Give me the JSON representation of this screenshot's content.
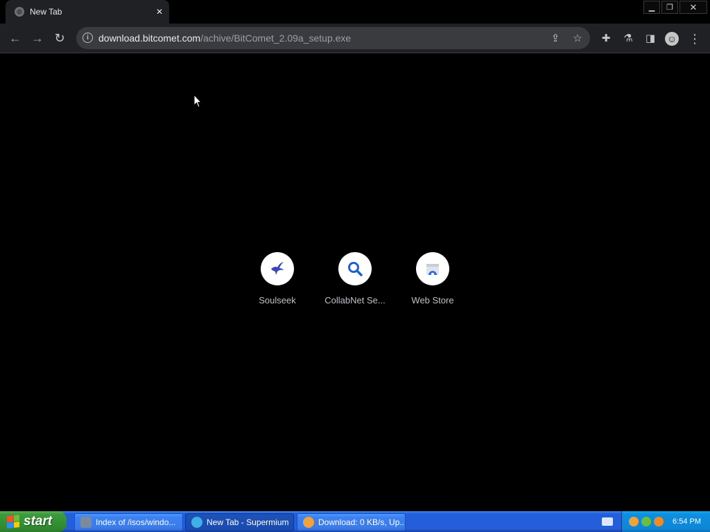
{
  "tab": {
    "title": "New Tab",
    "close_glyph": "✕"
  },
  "window_controls": {
    "minimize": "▁",
    "restore": "❐",
    "close": "✕"
  },
  "toolbar": {
    "back": "←",
    "forward": "→",
    "reload": "↻"
  },
  "omnibox": {
    "info_glyph": "i",
    "url_host": "download.bitcomet.com",
    "url_path": "/achive/BitComet_2.09a_setup.exe",
    "share_glyph": "⇪",
    "star_glyph": "☆"
  },
  "toolbar_icons": {
    "extensions": "✚",
    "labs": "⚗",
    "side_panel": "◨",
    "profile": "☺",
    "menu": "⋮"
  },
  "shortcuts": [
    {
      "label": "Soulseek",
      "icon": "bird-icon"
    },
    {
      "label": "CollabNet Se...",
      "icon": "search-icon"
    },
    {
      "label": "Web Store",
      "icon": "web-store-icon"
    }
  ],
  "taskbar": {
    "start_label": "start",
    "buttons": [
      {
        "label": "Index of /isos/windo...",
        "icon": "explorer-icon"
      },
      {
        "label": "New Tab - Supermium",
        "icon": "browser-icon",
        "active": true
      },
      {
        "label": "Download: 0 KB/s, Up...",
        "icon": "bitcomet-icon"
      }
    ],
    "clock": "6:54 PM"
  },
  "colors": {
    "page_background": "#000000",
    "toolbar": "#202124",
    "taskbar_blue": "#245edb",
    "start_green": "#3c9a3c"
  }
}
